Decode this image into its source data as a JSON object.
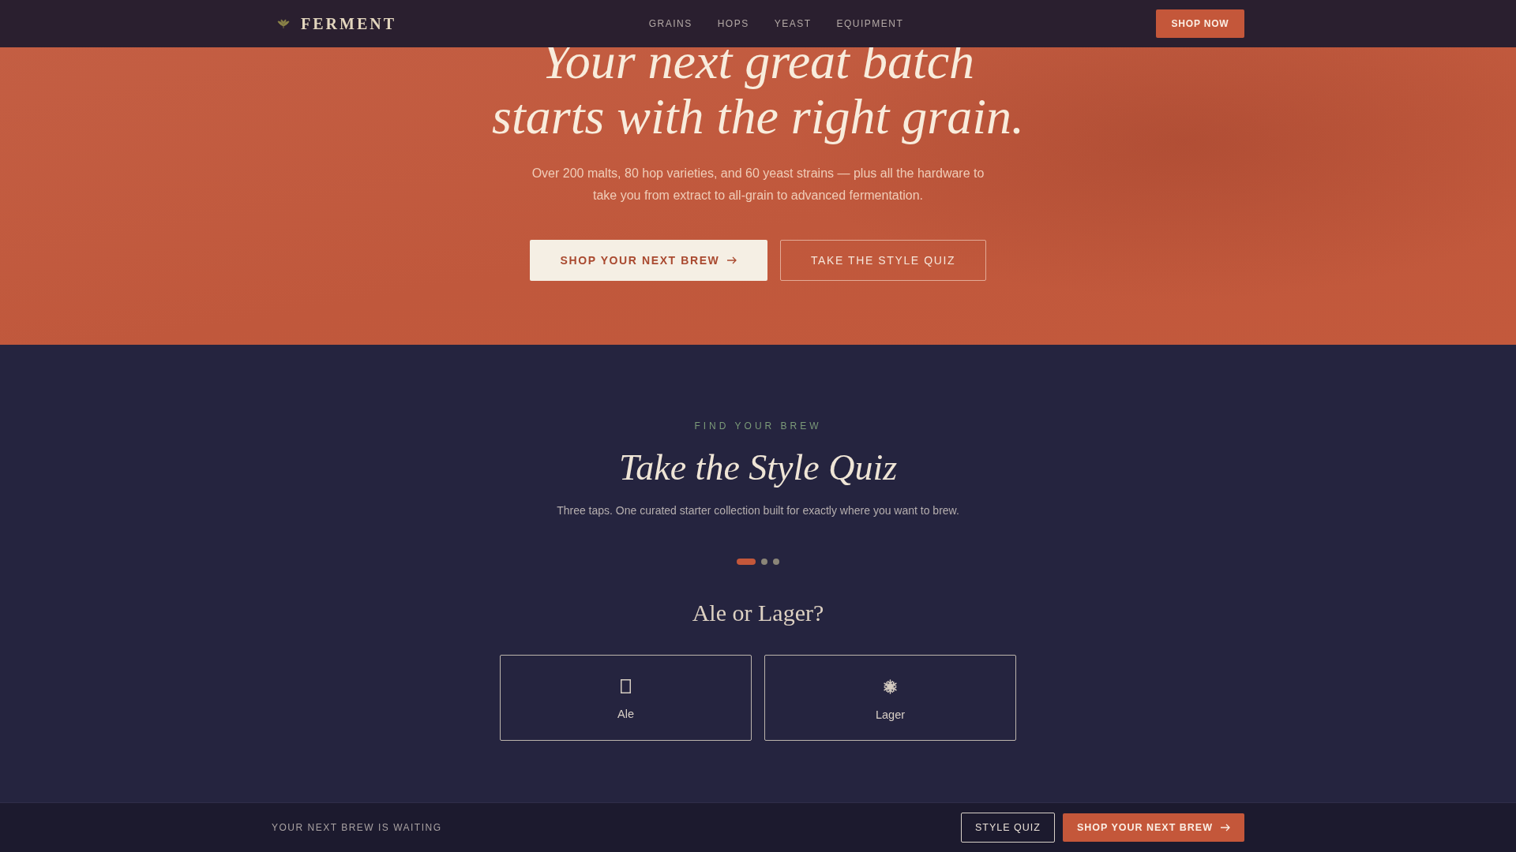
{
  "nav": {
    "logo": "FERMENT",
    "links": [
      {
        "label": "GRAINS"
      },
      {
        "label": "HOPS"
      },
      {
        "label": "YEAST"
      },
      {
        "label": "EQUIPMENT"
      }
    ],
    "cta": "SHOP NOW"
  },
  "hero": {
    "heading": "Your next great batch starts with the right grain.",
    "text": "Over 200 malts, 80 hop varieties, and 60 yeast strains — plus all the hardware to take you from extract to all-grain to advanced fermentation.",
    "buttons": [
      {
        "label": "SHOP YOUR NEXT BREW",
        "kind": "light"
      },
      {
        "label": "TAKE THE STYLE QUIZ",
        "kind": "outline"
      }
    ]
  },
  "quiz": {
    "eyebrow": "FIND YOUR BREW",
    "title": "Take the Style Quiz",
    "text": "Three taps. One curated starter collection built for exactly where you want to brew.",
    "steps": [
      {
        "selected": true
      },
      {
        "selected": false
      },
      {
        "selected": false
      }
    ],
    "question": "Ale or Lager?",
    "options": [
      {
        "label": "Ale"
      },
      {
        "label": "Lager"
      }
    ]
  },
  "sticky_bar": {
    "text": "YOUR NEXT BREW IS WAITING",
    "buttons": [
      {
        "label": "STYLE QUIZ",
        "kind": "outline"
      },
      {
        "label": "SHOP YOUR NEXT BREW",
        "kind": "primary"
      }
    ]
  }
}
